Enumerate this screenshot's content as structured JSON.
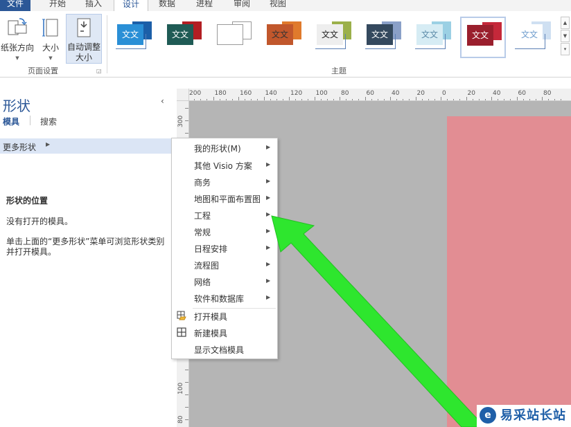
{
  "tabs": [
    {
      "label": "文件",
      "state": "file"
    },
    {
      "label": "开始",
      "state": "normal"
    },
    {
      "label": "插入",
      "state": "normal"
    },
    {
      "label": "设计",
      "state": "active"
    },
    {
      "label": "数据",
      "state": "normal"
    },
    {
      "label": "进程",
      "state": "normal"
    },
    {
      "label": "审阅",
      "state": "normal"
    },
    {
      "label": "视图",
      "state": "normal"
    }
  ],
  "ribbon": {
    "page_setup": {
      "orientation_label": "纸张方向",
      "size_label": "大小",
      "autosize_label_1": "自动调整",
      "autosize_label_2": "大小",
      "group_label": "页面设置"
    },
    "themes": {
      "group_label": "主题",
      "sample_text": "文文",
      "items": [
        {
          "back": "#1c5fa8",
          "front": "#2a8fd6",
          "text_color": "#ffffff",
          "frame": true
        },
        {
          "back": "#b21e23",
          "front": "#1f5b55",
          "text_color": "#ffffff",
          "frame": false
        },
        {
          "back": "#ffffff",
          "front": "#ffffff",
          "text_color": "#ffffff",
          "frame": false,
          "outline": true
        },
        {
          "back": "#e07a2c",
          "front": "#c1572c",
          "text_color": "#333333",
          "frame": false
        },
        {
          "back": "#9bb04a",
          "front": "#eeeeee",
          "text_color": "#222222",
          "frame": true
        },
        {
          "back": "#8aa0c8",
          "front": "#34495e",
          "text_color": "#ffffff",
          "frame": true
        },
        {
          "back": "#9bd0e4",
          "front": "#d6ecf4",
          "text_color": "#5a8aa8",
          "frame": true
        },
        {
          "back": "#c5283a",
          "front": "#9a1f2d",
          "text_color": "#ffffff",
          "frame": false,
          "selected": true
        },
        {
          "back": "#cfe0f2",
          "front": "#ffffff",
          "text_color": "#6e9ccd",
          "frame": true
        }
      ]
    }
  },
  "shapes_pane": {
    "title": "形状",
    "collapse_icon": "chevron-left-icon",
    "tab_stencils": "模具",
    "tab_search": "搜索",
    "more_shapes": "更多形状",
    "location_heading": "形状的位置",
    "no_stencils": "没有打开的模具。",
    "hint": "单击上面的“更多形状”菜单可浏览形状类别并打开模具。"
  },
  "ruler": {
    "h_labels": [
      "200",
      "180",
      "160",
      "140",
      "120",
      "100",
      "80",
      "60",
      "40",
      "20",
      "0",
      "20",
      "40",
      "60",
      "80"
    ],
    "v_labels": [
      "300",
      "100",
      "80"
    ]
  },
  "menu": {
    "items": [
      {
        "label": "我的形状(M)",
        "submenu": true
      },
      {
        "label": "其他 Visio 方案",
        "submenu": true
      },
      {
        "label": "商务",
        "submenu": true
      },
      {
        "label": "地图和平面布置图",
        "submenu": true
      },
      {
        "label": "工程",
        "submenu": true
      },
      {
        "label": "常规",
        "submenu": true
      },
      {
        "label": "日程安排",
        "submenu": true
      },
      {
        "label": "流程图",
        "submenu": true
      },
      {
        "label": "网络",
        "submenu": true
      },
      {
        "label": "软件和数据库",
        "submenu": true
      },
      {
        "label": "打开模具",
        "submenu": false,
        "icon": "open-stencil-icon"
      },
      {
        "label": "新建模具",
        "submenu": false,
        "icon": "new-stencil-icon"
      },
      {
        "label": "显示文档模具",
        "submenu": false
      }
    ]
  },
  "colors": {
    "accent": "#2b5797",
    "canvas": "#b5b5b5",
    "page": "#e28d93",
    "arrow": "#2ee62e"
  },
  "watermark": {
    "text": "易采站长站",
    "logo_glyph": "e"
  }
}
